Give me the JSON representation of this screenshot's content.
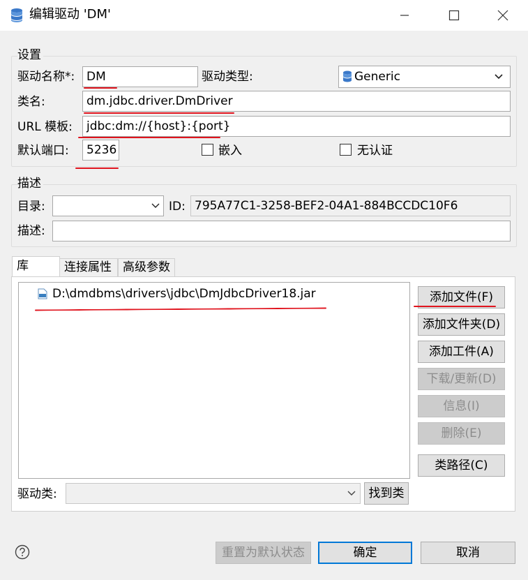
{
  "window": {
    "title": "编辑驱动 'DM'",
    "minimize_icon": "minimize-icon",
    "maximize_icon": "maximize-icon",
    "close_icon": "close-icon"
  },
  "settings": {
    "group_label": "设置",
    "driver_name_label": "驱动名称*:",
    "driver_name_value": "DM",
    "driver_type_label": "驱动类型:",
    "driver_type_value": "Generic",
    "class_name_label": "类名:",
    "class_name_value": "dm.jdbc.driver.DmDriver",
    "url_template_label": "URL 模板:",
    "url_template_value": "jdbc:dm://{host}:{port}",
    "default_port_label": "默认端口:",
    "default_port_value": "5236",
    "embedded_label": "嵌入",
    "embedded_checked": false,
    "no_auth_label": "无认证",
    "no_auth_checked": false
  },
  "description": {
    "group_label": "描述",
    "category_label": "目录:",
    "category_value": "",
    "id_label": "ID:",
    "id_value": "795A77C1-3258-BEF2-04A1-884BCCDC10F6",
    "desc_label": "描述:",
    "desc_value": ""
  },
  "tabs": [
    {
      "label": "库",
      "active": true
    },
    {
      "label": "连接属性",
      "active": false
    },
    {
      "label": "高级参数",
      "active": false
    }
  ],
  "libraries": {
    "files": [
      "D:\\dmdbms\\drivers\\jdbc\\DmJdbcDriver18.jar"
    ],
    "buttons": {
      "add_file": "添加文件(F)",
      "add_folder": "添加文件夹(D)",
      "add_artifact": "添加工件(A)",
      "download_update": "下载/更新(D)",
      "info": "信息(I)",
      "delete": "删除(E)",
      "classpath": "类路径(C)"
    },
    "driver_class_label": "驱动类:",
    "driver_class_value": "",
    "find_class_button": "找到类"
  },
  "footer": {
    "help_icon": "help-icon",
    "reset_button": "重置为默认状态",
    "ok_button": "确定",
    "cancel_button": "取消"
  },
  "colors": {
    "accent": "#0078d7",
    "annotation_red": "#e0141e",
    "window_bg": "#f0f0f0"
  }
}
